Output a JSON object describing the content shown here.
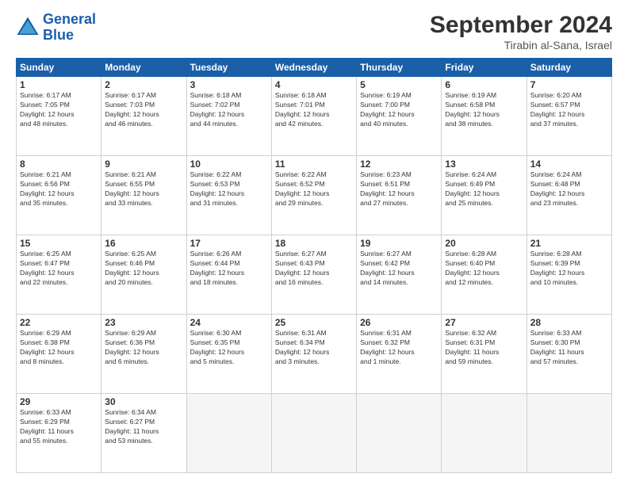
{
  "header": {
    "logo_line1": "General",
    "logo_line2": "Blue",
    "month_title": "September 2024",
    "location": "Tirabin al-Sana, Israel"
  },
  "weekdays": [
    "Sunday",
    "Monday",
    "Tuesday",
    "Wednesday",
    "Thursday",
    "Friday",
    "Saturday"
  ],
  "weeks": [
    [
      {
        "day": "1",
        "info": "Sunrise: 6:17 AM\nSunset: 7:05 PM\nDaylight: 12 hours\nand 48 minutes."
      },
      {
        "day": "2",
        "info": "Sunrise: 6:17 AM\nSunset: 7:03 PM\nDaylight: 12 hours\nand 46 minutes."
      },
      {
        "day": "3",
        "info": "Sunrise: 6:18 AM\nSunset: 7:02 PM\nDaylight: 12 hours\nand 44 minutes."
      },
      {
        "day": "4",
        "info": "Sunrise: 6:18 AM\nSunset: 7:01 PM\nDaylight: 12 hours\nand 42 minutes."
      },
      {
        "day": "5",
        "info": "Sunrise: 6:19 AM\nSunset: 7:00 PM\nDaylight: 12 hours\nand 40 minutes."
      },
      {
        "day": "6",
        "info": "Sunrise: 6:19 AM\nSunset: 6:58 PM\nDaylight: 12 hours\nand 38 minutes."
      },
      {
        "day": "7",
        "info": "Sunrise: 6:20 AM\nSunset: 6:57 PM\nDaylight: 12 hours\nand 37 minutes."
      }
    ],
    [
      {
        "day": "8",
        "info": "Sunrise: 6:21 AM\nSunset: 6:56 PM\nDaylight: 12 hours\nand 35 minutes."
      },
      {
        "day": "9",
        "info": "Sunrise: 6:21 AM\nSunset: 6:55 PM\nDaylight: 12 hours\nand 33 minutes."
      },
      {
        "day": "10",
        "info": "Sunrise: 6:22 AM\nSunset: 6:53 PM\nDaylight: 12 hours\nand 31 minutes."
      },
      {
        "day": "11",
        "info": "Sunrise: 6:22 AM\nSunset: 6:52 PM\nDaylight: 12 hours\nand 29 minutes."
      },
      {
        "day": "12",
        "info": "Sunrise: 6:23 AM\nSunset: 6:51 PM\nDaylight: 12 hours\nand 27 minutes."
      },
      {
        "day": "13",
        "info": "Sunrise: 6:24 AM\nSunset: 6:49 PM\nDaylight: 12 hours\nand 25 minutes."
      },
      {
        "day": "14",
        "info": "Sunrise: 6:24 AM\nSunset: 6:48 PM\nDaylight: 12 hours\nand 23 minutes."
      }
    ],
    [
      {
        "day": "15",
        "info": "Sunrise: 6:25 AM\nSunset: 6:47 PM\nDaylight: 12 hours\nand 22 minutes."
      },
      {
        "day": "16",
        "info": "Sunrise: 6:25 AM\nSunset: 6:46 PM\nDaylight: 12 hours\nand 20 minutes."
      },
      {
        "day": "17",
        "info": "Sunrise: 6:26 AM\nSunset: 6:44 PM\nDaylight: 12 hours\nand 18 minutes."
      },
      {
        "day": "18",
        "info": "Sunrise: 6:27 AM\nSunset: 6:43 PM\nDaylight: 12 hours\nand 16 minutes."
      },
      {
        "day": "19",
        "info": "Sunrise: 6:27 AM\nSunset: 6:42 PM\nDaylight: 12 hours\nand 14 minutes."
      },
      {
        "day": "20",
        "info": "Sunrise: 6:28 AM\nSunset: 6:40 PM\nDaylight: 12 hours\nand 12 minutes."
      },
      {
        "day": "21",
        "info": "Sunrise: 6:28 AM\nSunset: 6:39 PM\nDaylight: 12 hours\nand 10 minutes."
      }
    ],
    [
      {
        "day": "22",
        "info": "Sunrise: 6:29 AM\nSunset: 6:38 PM\nDaylight: 12 hours\nand 8 minutes."
      },
      {
        "day": "23",
        "info": "Sunrise: 6:29 AM\nSunset: 6:36 PM\nDaylight: 12 hours\nand 6 minutes."
      },
      {
        "day": "24",
        "info": "Sunrise: 6:30 AM\nSunset: 6:35 PM\nDaylight: 12 hours\nand 5 minutes."
      },
      {
        "day": "25",
        "info": "Sunrise: 6:31 AM\nSunset: 6:34 PM\nDaylight: 12 hours\nand 3 minutes."
      },
      {
        "day": "26",
        "info": "Sunrise: 6:31 AM\nSunset: 6:32 PM\nDaylight: 12 hours\nand 1 minute."
      },
      {
        "day": "27",
        "info": "Sunrise: 6:32 AM\nSunset: 6:31 PM\nDaylight: 11 hours\nand 59 minutes."
      },
      {
        "day": "28",
        "info": "Sunrise: 6:33 AM\nSunset: 6:30 PM\nDaylight: 11 hours\nand 57 minutes."
      }
    ],
    [
      {
        "day": "29",
        "info": "Sunrise: 6:33 AM\nSunset: 6:29 PM\nDaylight: 11 hours\nand 55 minutes."
      },
      {
        "day": "30",
        "info": "Sunrise: 6:34 AM\nSunset: 6:27 PM\nDaylight: 11 hours\nand 53 minutes."
      },
      {
        "day": "",
        "info": ""
      },
      {
        "day": "",
        "info": ""
      },
      {
        "day": "",
        "info": ""
      },
      {
        "day": "",
        "info": ""
      },
      {
        "day": "",
        "info": ""
      }
    ]
  ]
}
